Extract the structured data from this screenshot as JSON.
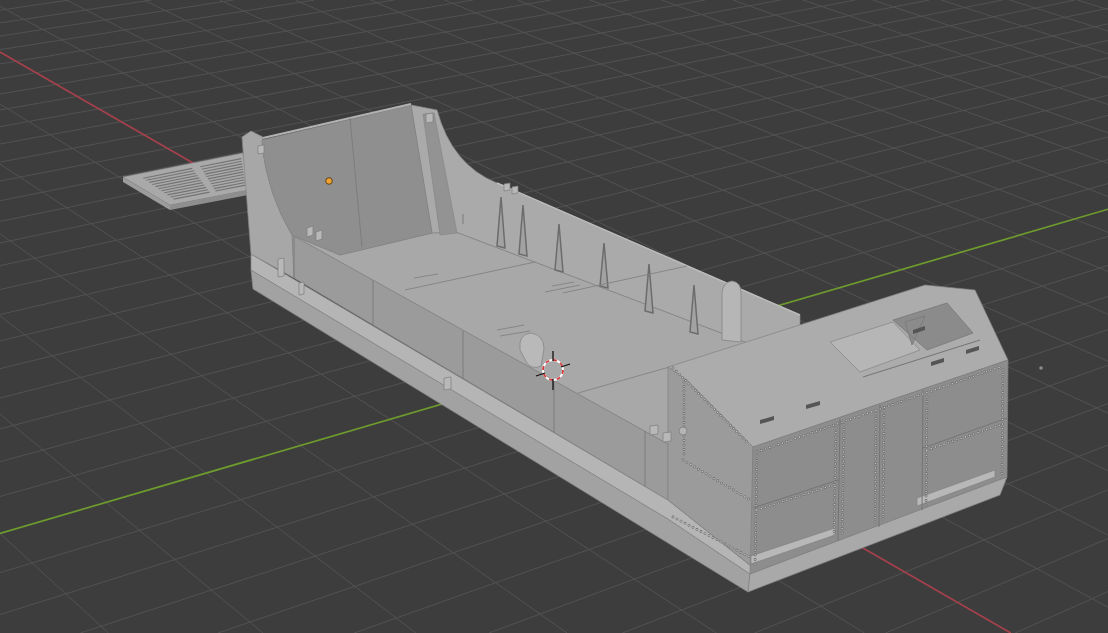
{
  "viewport": {
    "axis_lines": [
      {
        "color": "#a5414b"
      },
      {
        "color": "#6e9b2d"
      }
    ],
    "objects": [
      {
        "kind": "ramp"
      },
      {
        "kind": "hull"
      }
    ]
  }
}
